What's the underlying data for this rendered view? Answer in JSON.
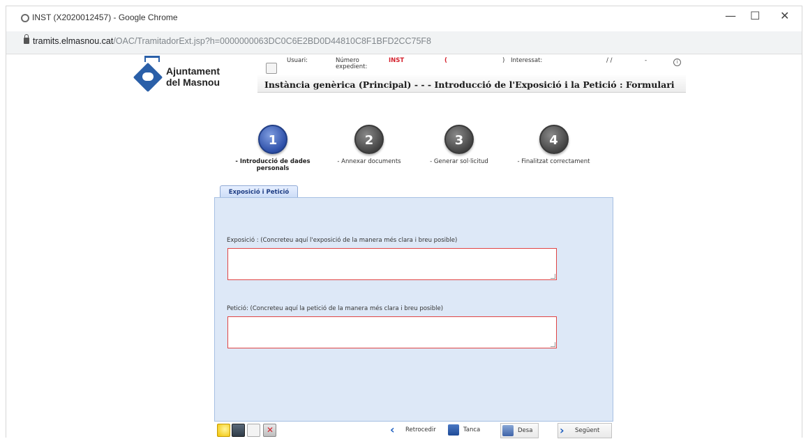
{
  "window": {
    "title": "INST (X2020012457) - Google Chrome",
    "controls": {
      "minimize": "—",
      "maximize": "☐",
      "close": "✕"
    }
  },
  "address": {
    "host": "tramits.elmasnou.cat",
    "path": "/OAC/TramitadorExt.jsp?h=0000000063DC0C6E2BD0D44810C8F1BFD2CC75F8"
  },
  "header": {
    "logo_line1": "Ajuntament",
    "logo_line2": "del Masnou",
    "usuari_label": "Usuari:",
    "numero_label_1": "Número",
    "numero_label_2": "expedient:",
    "numero_value": "INST",
    "paren_open": "(",
    "paren_close": ")",
    "interessat_label": "Interessat:",
    "date_sep": "/   /",
    "dash": "-",
    "info_icon": "i",
    "page_title": "Instància genèrica (Principal) - - - Introducció de l'Exposició i la Petició : Formulari"
  },
  "steps": [
    {
      "num": "1",
      "label": "- Introducció de dades personals",
      "active": true
    },
    {
      "num": "2",
      "label": "- Annexar documents",
      "active": false
    },
    {
      "num": "3",
      "label": "- Generar sol·licitud",
      "active": false
    },
    {
      "num": "4",
      "label": "- Finalitzat correctament",
      "active": false
    }
  ],
  "form": {
    "tab_label": "Exposició i Petició",
    "exposicio_label": "Exposició : (Concreteu aquí l'exposició de la manera més clara i breu posible)",
    "exposicio_value": "",
    "peticio_label": "Petició: (Concreteu aquí la petició de la manera més clara i breu posible)",
    "peticio_value": ""
  },
  "toolbar": {
    "back_label": "Retrocedir",
    "close_label": "Tanca",
    "save_label": "Desa",
    "next_label": "Següent"
  },
  "colors": {
    "brand_blue": "#2a5fa8",
    "accent_red": "#d41f2b",
    "panel_bg": "#dde8f7",
    "field_border": "#e04444"
  }
}
